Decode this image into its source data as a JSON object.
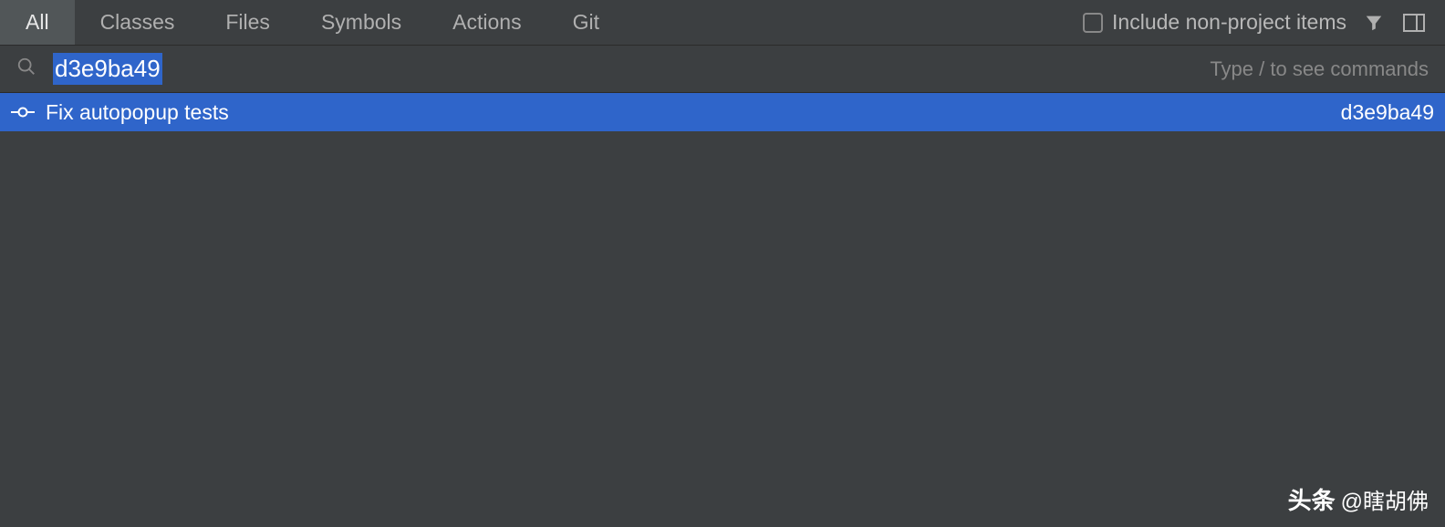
{
  "tabs": {
    "items": [
      {
        "label": "All",
        "active": true
      },
      {
        "label": "Classes",
        "active": false
      },
      {
        "label": "Files",
        "active": false
      },
      {
        "label": "Symbols",
        "active": false
      },
      {
        "label": "Actions",
        "active": false
      },
      {
        "label": "Git",
        "active": false
      }
    ],
    "checkbox_label": "Include non-project items"
  },
  "search": {
    "value": "d3e9ba49",
    "hint": "Type / to see commands"
  },
  "results": [
    {
      "title": "Fix autopopup tests",
      "hash": "d3e9ba49",
      "selected": true
    }
  ],
  "watermark": {
    "brand": "头条",
    "at": "@瞎胡佛"
  }
}
